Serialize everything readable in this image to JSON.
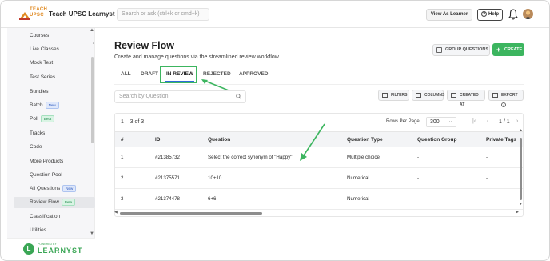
{
  "app": {
    "brand": "Teach UPSC Learnyst",
    "logo_text_line1": "TEACH",
    "logo_text_line2": "UPSC",
    "search_placeholder": "Search or ask (ctrl+k or cmd+k)",
    "view_as_learner": "View As Learner",
    "help": "Help"
  },
  "sidebar": {
    "items": [
      {
        "label": "Courses"
      },
      {
        "label": "Live Classes"
      },
      {
        "label": "Mock Test"
      },
      {
        "label": "Test Series"
      },
      {
        "label": "Bundles"
      },
      {
        "label": "Batch",
        "badge": "New"
      },
      {
        "label": "Poll",
        "badge": "Beta"
      },
      {
        "label": "Tracks"
      },
      {
        "label": "Code"
      },
      {
        "label": "More Products"
      },
      {
        "label": "Question Pool"
      },
      {
        "label": "All Questions",
        "badge": "New"
      },
      {
        "label": "Review Flow",
        "badge": "Beta"
      },
      {
        "label": "Classification"
      },
      {
        "label": "Utilities"
      }
    ],
    "powered_by": "POWERED BY",
    "footer_brand": "LEARNYST"
  },
  "page": {
    "title": "Review Flow",
    "subtitle": "Create and manage questions via the streamlined review workflow",
    "group_questions": "GROUP QUESTIONS",
    "create": "CREATE"
  },
  "tabs": [
    {
      "label": "ALL"
    },
    {
      "label": "DRAFT"
    },
    {
      "label": "IN REVIEW",
      "active": true
    },
    {
      "label": "REJECTED"
    },
    {
      "label": "APPROVED"
    }
  ],
  "toolbar": {
    "search_placeholder": "Search by Question",
    "filters": "FILTERS",
    "columns": "COLUMNS",
    "created_at": "CREATED AT",
    "export": "EXPORT"
  },
  "table": {
    "count": "1 – 3 of 3",
    "rows_per_page_label": "Rows Per Page",
    "rows_per_page_value": "300",
    "page_indicator": "1 / 1",
    "columns": [
      "#",
      "ID",
      "Question",
      "Question Type",
      "Question Group",
      "Private Tags"
    ],
    "rows": [
      {
        "num": "1",
        "id": "#21385732",
        "question": "Select the correct synonym of \"Happy\"",
        "type": "Multiple choice",
        "group": "-",
        "tags": "-"
      },
      {
        "num": "2",
        "id": "#21375571",
        "question": "10+10",
        "type": "Numerical",
        "group": "-",
        "tags": "-"
      },
      {
        "num": "3",
        "id": "#21374478",
        "question": "6+6",
        "type": "Numerical",
        "group": "-",
        "tags": "-"
      }
    ]
  },
  "colors": {
    "accent_green": "#3cb55f",
    "tab_underline": "#2d6ad6"
  }
}
